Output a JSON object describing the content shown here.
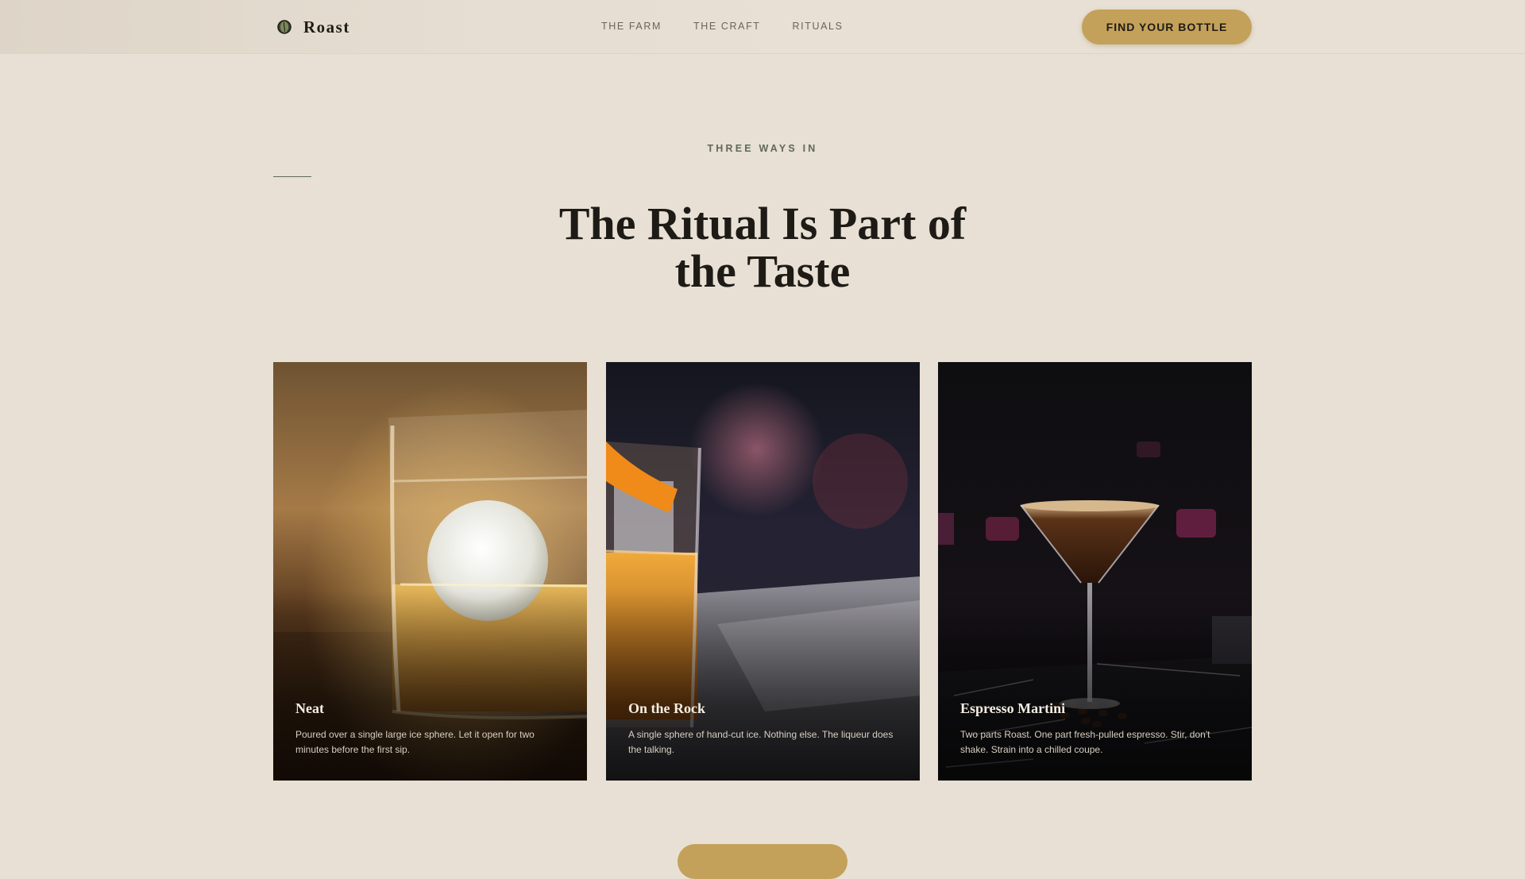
{
  "header": {
    "brand": "Roast",
    "nav": [
      "THE FARM",
      "THE CRAFT",
      "RITUALS"
    ],
    "cta_label": "FIND YOUR BOTTLE"
  },
  "section": {
    "eyebrow": "THREE WAYS IN",
    "title_line1": "The Ritual Is Part of",
    "title_line2": "the Taste"
  },
  "cards": [
    {
      "title": "Neat",
      "text": "Poured over a single large ice sphere. Let it open for two minutes before the first sip."
    },
    {
      "title": "On the Rock",
      "text": "A single sphere of hand-cut ice. Nothing else. The liqueur does the talking."
    },
    {
      "title": "Espresso Martini",
      "text": "Two parts Roast. One part fresh-pulled espresso. Stir, don't shake. Strain into a chilled coupe."
    }
  ],
  "colors": {
    "background": "#e8e0d4",
    "accent": "#c4a15a",
    "eyebrow": "#5e6a55",
    "text": "#1e1b17"
  }
}
